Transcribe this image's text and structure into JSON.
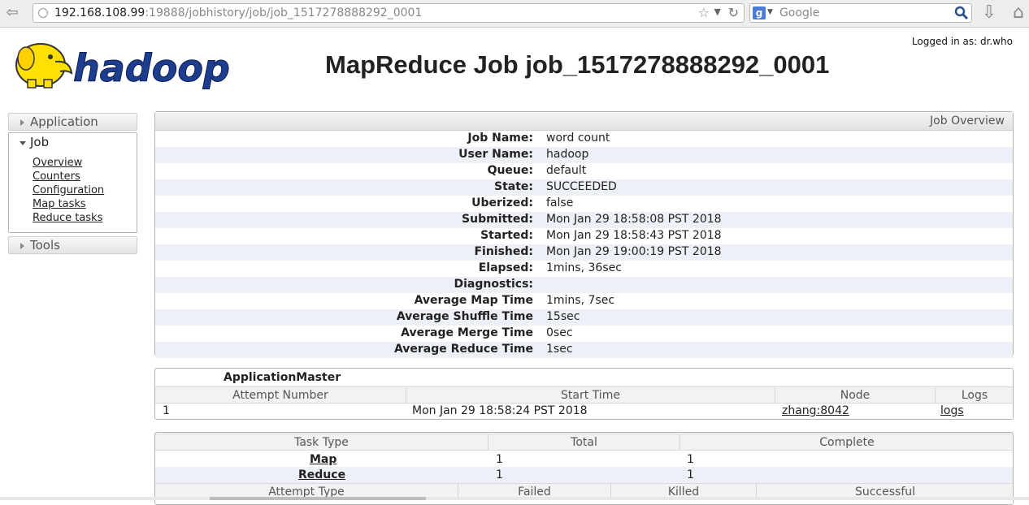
{
  "browser": {
    "url_host": "192.168.108.99",
    "url_path": ":19888/jobhistory/job/job_1517278888292_0001",
    "search_placeholder": "Google"
  },
  "header": {
    "logo_text": "hadoop",
    "title": "MapReduce Job job_1517278888292_0001",
    "logged_in": "Logged in as: dr.who"
  },
  "nav": {
    "application": "Application",
    "job": "Job",
    "job_links": [
      "Overview",
      "Counters",
      "Configuration",
      "Map tasks",
      "Reduce tasks"
    ],
    "tools": "Tools"
  },
  "overview": {
    "heading": "Job Overview",
    "rows": [
      {
        "key": "Job Name:",
        "value": "word count"
      },
      {
        "key": "User Name:",
        "value": "hadoop"
      },
      {
        "key": "Queue:",
        "value": "default"
      },
      {
        "key": "State:",
        "value": "SUCCEEDED"
      },
      {
        "key": "Uberized:",
        "value": "false"
      },
      {
        "key": "Submitted:",
        "value": "Mon Jan 29 18:58:08 PST 2018"
      },
      {
        "key": "Started:",
        "value": "Mon Jan 29 18:58:43 PST 2018"
      },
      {
        "key": "Finished:",
        "value": "Mon Jan 29 19:00:19 PST 2018"
      },
      {
        "key": "Elapsed:",
        "value": "1mins, 36sec"
      },
      {
        "key": "Diagnostics:",
        "value": ""
      },
      {
        "key": "Average Map Time",
        "value": "1mins, 7sec"
      },
      {
        "key": "Average Shuffle Time",
        "value": "15sec"
      },
      {
        "key": "Average Merge Time",
        "value": "0sec"
      },
      {
        "key": "Average Reduce Time",
        "value": "1sec"
      }
    ]
  },
  "app_master": {
    "title": "ApplicationMaster",
    "headers": [
      "Attempt Number",
      "Start Time",
      "Node",
      "Logs"
    ],
    "row": {
      "attempt": "1",
      "start_time": "Mon Jan 29 18:58:24 PST 2018",
      "node": "zhang:8042",
      "logs": "logs"
    }
  },
  "tasks": {
    "headers": [
      "Task Type",
      "Total",
      "Complete"
    ],
    "rows": [
      {
        "type": "Map",
        "total": "1",
        "complete": "1"
      },
      {
        "type": "Reduce",
        "total": "1",
        "complete": "1"
      }
    ],
    "attempt_headers": [
      "Attempt Type",
      "Failed",
      "Killed",
      "Successful"
    ]
  }
}
